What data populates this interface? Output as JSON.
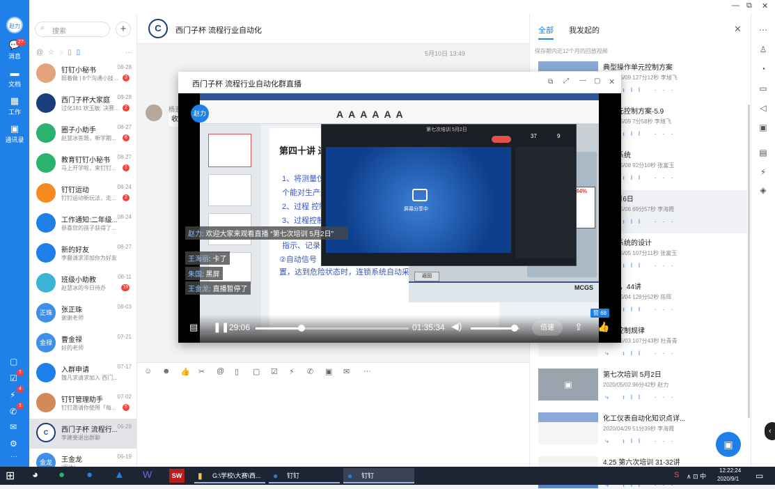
{
  "window_controls": {
    "minimize": "—",
    "restore": "⧉",
    "close": "✕"
  },
  "navbar": {
    "avatar_text": "赵力",
    "items": [
      {
        "label": "消息",
        "badge": "27"
      },
      {
        "label": "文档"
      },
      {
        "label": "工作"
      },
      {
        "label": "通讯录"
      }
    ],
    "bottom_badges": [
      "1",
      "4",
      "1"
    ]
  },
  "search": {
    "placeholder": "搜索",
    "add": "+"
  },
  "filter_more": "···",
  "chats": [
    {
      "name": "钉钉小秘书",
      "preview": "照着做 | 8个沟通小技...",
      "date": "08-28",
      "badge": "3",
      "color": "#e3a37c"
    },
    {
      "name": "西门子杯大家庭",
      "preview": "过化181 状玉敏: 决赛...",
      "date": "08-28",
      "badge": "2",
      "color": "#1a3d7c"
    },
    {
      "name": "圈子小助手",
      "preview": "赵慧冰答题，新学期...",
      "date": "08-27",
      "badge": "6",
      "color": "#2bb36d"
    },
    {
      "name": "教育钉钉小秘书",
      "preview": "马上开学啦，来钉钉...",
      "date": "08-27",
      "badge": "1",
      "color": "#2bb36d"
    },
    {
      "name": "钉钉运动",
      "preview": "钉钉运动新玩法，走...",
      "date": "08-24",
      "badge": "2",
      "color": "#f58b1f"
    },
    {
      "name": "工作通知:二年级...",
      "preview": "恭喜您的孩子获得了...",
      "date": "08-24",
      "badge": "",
      "color": "#1e80e8"
    },
    {
      "name": "新的好友",
      "preview": "李晨请求添加你为好友",
      "date": "08-27",
      "badge": "",
      "color": "#1e80e8"
    },
    {
      "name": "班级小助教",
      "preview": "赵慧冰的今日待办",
      "date": "08-11",
      "badge": "19",
      "color": "#3ab3d4"
    },
    {
      "name": "张正珠",
      "preview": "谢谢老师",
      "date": "08-03",
      "badge": "",
      "color": "#3f8fe8",
      "avatar_text": "正珠"
    },
    {
      "name": "曹金禄",
      "preview": "好的老师",
      "date": "07-21",
      "badge": "",
      "color": "#3f8fe8",
      "avatar_text": "金禄"
    },
    {
      "name": "入群申请",
      "preview": "魏凡求请求加入 西门...",
      "date": "07-17",
      "badge": "",
      "color": "#1e80e8"
    },
    {
      "name": "钉钉管理助手",
      "preview": "钉钉邀请你使用「每...",
      "date": "07-02",
      "badge": "5",
      "color": "#d38a5a"
    },
    {
      "name": "西门子杯 流程行...",
      "preview": "李建斐退出群聊",
      "date": "06-28",
      "badge": "",
      "color": "#ffffff",
      "avatar_text": "C"
    },
    {
      "name": "王金龙",
      "preview": "[图片]",
      "date": "06-19",
      "badge": "",
      "color": "#3f8fe8",
      "avatar_text": "金龙"
    }
  ],
  "chat_header": {
    "title": "西门子杯 流程行业自动化"
  },
  "chat_area": {
    "timestamp": "5月10日 13:49",
    "sender": "杨丑",
    "bubble": "收"
  },
  "player": {
    "title": "西门子杯 流程行业自动化群直播",
    "presenter": "赵力",
    "slide": {
      "title": "第四十讲 过",
      "line1": "1、将测量仪",
      "line1b": "个能对生产过",
      "line2": "2、过程 控制",
      "line3": "3、过程控制",
      "line4": "指示、记录",
      "line5": "②自动信号",
      "line6": "置，达到危险状态时，连锁系统自动采"
    },
    "inner_window_title": "第七次培训 5月2日",
    "inner_counts": [
      "37",
      "9"
    ],
    "inner_prompt": "屏幕分享中",
    "scada_label": "MCGS",
    "scada_value": "44%",
    "scada_button": "返回",
    "comments": [
      {
        "name": "赵力",
        "text": ": 欢迎大家来观看直播 “第七次培训 5月2日”"
      },
      {
        "name": "王海丽",
        "text": ": 卡了"
      },
      {
        "name": "朱国",
        "text": ": 黑屏"
      },
      {
        "name": "王金龙",
        "text": ": 直播暂停了"
      }
    ],
    "like_count": "赞 68",
    "time_current": "29:06",
    "time_total": "01:35:34",
    "progress": 0.3,
    "volume": 0.9,
    "speed_label": "倍速"
  },
  "right_panel": {
    "tabs": [
      "全部",
      "我发起的"
    ],
    "subtitle": "保存期内近12个月的回放视频",
    "recordings": [
      {
        "title": "典型操作单元控制方案",
        "meta": "2020/05/09 127分12秒 李旭飞"
      },
      {
        "title": "型单元控制方案-5.9",
        "meta": "2020/05/09 7分58秒 李旭飞"
      },
      {
        "title": "控制系统",
        "meta": "2020/05/08 92分10秒 张富玉"
      },
      {
        "title": "训 5月6日",
        "meta": "2020/05/06 69分57秒 李海霞"
      },
      {
        "title": "控制系统的设计",
        "meta": "2020/05/05 107分11秒 张富玉"
      },
      {
        "title": "训 43，44讲",
        "meta": "2020/05/04 128分52秒 陈晖"
      },
      {
        "title": "系与控制规律",
        "meta": "2020/05/03 107分43秒 杜青青"
      },
      {
        "title": "第七次培训 5月2日",
        "meta": "2020/05/02 96分42秒 赵力"
      },
      {
        "title": "化工仪表自动化知识点详...",
        "meta": "2020/04/29 51分39秒 李海霞"
      },
      {
        "title": "4.25 第六次培训 31-32讲",
        "meta": ""
      }
    ],
    "action_icons": "⤷ ıll ···"
  },
  "taskbar": {
    "apps": [
      "G:\\学校\\大赛\\西...",
      "钉钉",
      "钉钉"
    ],
    "time": "12:22:24",
    "date": "2020/9/1",
    "tray": "∧  ⊡  中",
    "sw_label": "SW"
  },
  "colors": {
    "accent": "#1e80e8",
    "badge": "#f5423d"
  }
}
